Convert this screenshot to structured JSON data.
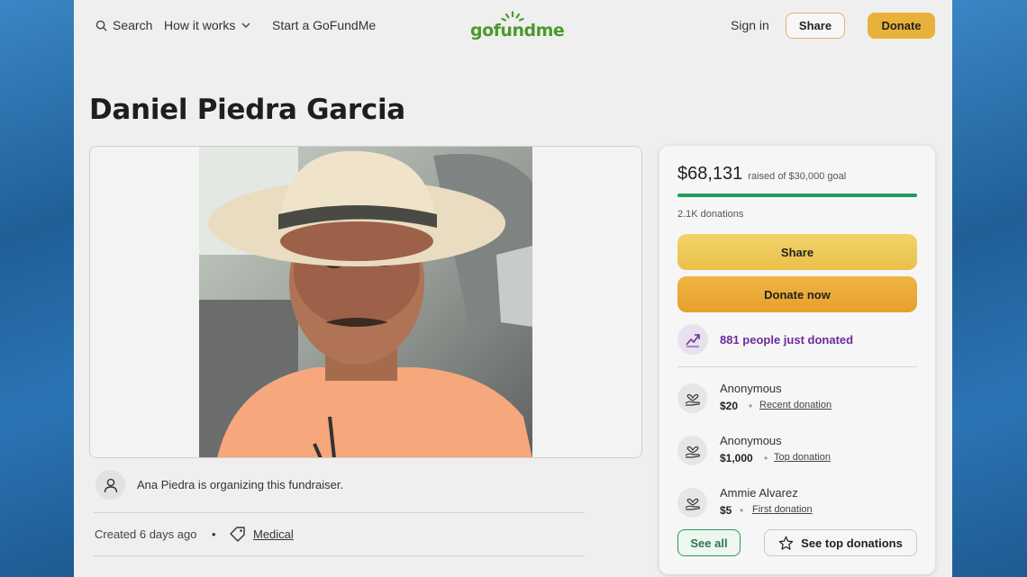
{
  "nav": {
    "search_label": "Search",
    "how_label": "How it works",
    "start_label": "Start a GoFundMe",
    "logo_text": "gofundme",
    "signin_label": "Sign in",
    "share_label": "Share",
    "donate_label": "Donate"
  },
  "fundraiser": {
    "title": "Daniel Piedra Garcia",
    "organizer_text": "Ana Piedra is organizing this fundraiser.",
    "created": "Created 6 days ago",
    "separator": "•",
    "category": "Medical"
  },
  "card": {
    "raised_amount": "$68,131",
    "goal_text": "raised of $30,000 goal",
    "progress_fraction": 1.0,
    "donations_count": "2.1K donations",
    "share_button": "Share",
    "donate_button": "Donate now",
    "trending_text": "881 people just donated",
    "donors": [
      {
        "name": "Anonymous",
        "amount": "$20",
        "type": "Recent donation"
      },
      {
        "name": "Anonymous",
        "amount": "$1,000",
        "type": "Top donation"
      },
      {
        "name": "Ammie Alvarez",
        "amount": "$5",
        "type": "First donation"
      }
    ],
    "see_all": "See all",
    "see_top": "See top donations"
  },
  "colors": {
    "brand_green": "#4a9a2c",
    "progress_green": "#1e9e58",
    "donate_orange": "#e6a12a",
    "trending_purple": "#6c2b9a"
  }
}
